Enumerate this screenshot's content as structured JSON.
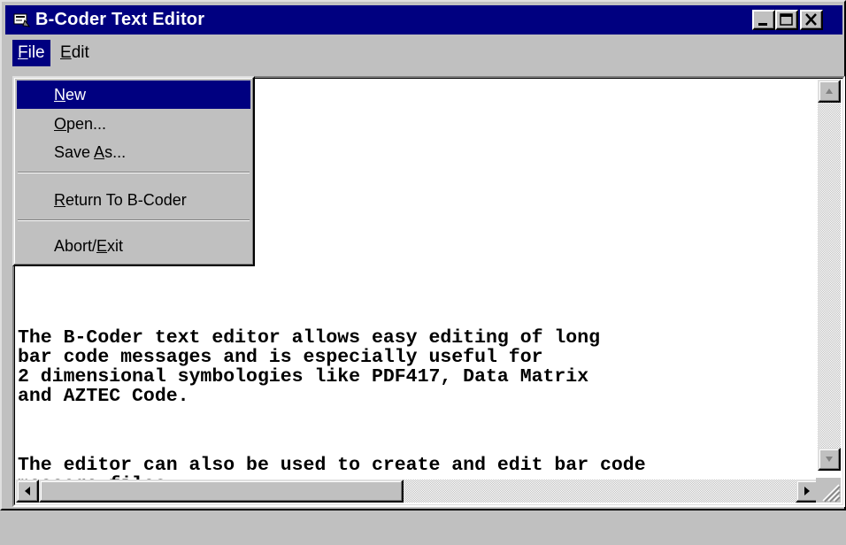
{
  "window": {
    "title": "B-Coder Text Editor"
  },
  "menubar": {
    "file": {
      "underline": "F",
      "rest": "ile"
    },
    "edit": {
      "underline": "E",
      "rest": "dit"
    }
  },
  "file_menu": {
    "new": {
      "pre": "",
      "underline": "N",
      "rest": "ew"
    },
    "open": {
      "pre": "",
      "underline": "O",
      "rest": "pen..."
    },
    "saveas": {
      "pre": "Save ",
      "underline": "A",
      "rest": "s..."
    },
    "return": {
      "pre": "",
      "underline": "R",
      "rest": "eturn To B-Coder"
    },
    "exit": {
      "pre": "Abort/",
      "underline": "E",
      "rest": "xit"
    }
  },
  "editor": {
    "lines": [
      "The B-Coder text editor allows easy editing of long",
      "bar code messages and is especially useful for",
      "2 dimensional symbologies like PDF417, Data Matrix",
      "and AZTEC Code.",
      "The editor can also be used to create and edit bar code",
      "message files."
    ]
  },
  "colors": {
    "titlebar": "#000080",
    "face": "#c0c0c0",
    "highlight": "#000080"
  },
  "icons": [
    "app-icon",
    "minimize-icon",
    "maximize-icon",
    "close-icon",
    "scroll-up-icon",
    "scroll-down-icon",
    "scroll-left-icon",
    "scroll-right-icon",
    "size-grip-icon"
  ]
}
